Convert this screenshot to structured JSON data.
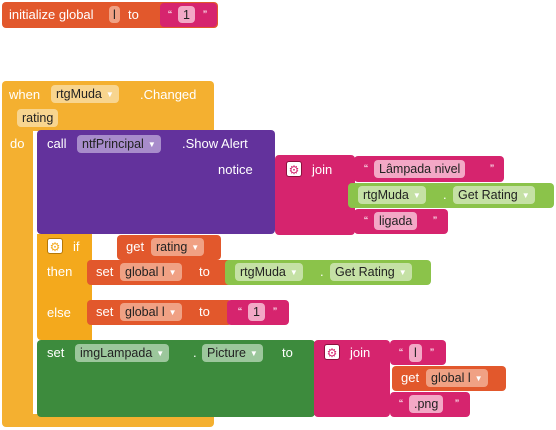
{
  "colors": {
    "orange": "#F4B030",
    "variable": "#E2582C",
    "text_block": "#D6246E",
    "component_purple": "#63329C",
    "component_green": "#3D8B3D",
    "getter_lime": "#8BC34A",
    "control_orange": "#F4A91C"
  },
  "init_global": {
    "label_initialize": "initialize global",
    "var_name": "l",
    "label_to": "to",
    "open_quote": "“",
    "value": "1",
    "close_quote": "”"
  },
  "event": {
    "label_when": "when",
    "component": "rtgMuda",
    "event_name": ".Changed",
    "param": "rating",
    "label_do": "do"
  },
  "call_block": {
    "label_call": "call",
    "component": "ntfPrincipal",
    "method": ".Show Alert",
    "arg_label": "notice",
    "join_label": "join",
    "text1": "Lâmpada nivel",
    "getter_component": "rtgMuda",
    "getter_dot": ".",
    "getter_property": "Get Rating",
    "text2": "ligada"
  },
  "if_block": {
    "label_if": "if",
    "get_label": "get",
    "get_var": "rating",
    "label_then": "then",
    "then_set": "set",
    "then_var": "global l",
    "then_to": "to",
    "then_component": "rtgMuda",
    "then_dot": ".",
    "then_property": "Get Rating",
    "label_else": "else",
    "else_set": "set",
    "else_var": "global l",
    "else_to": "to",
    "else_value": "1"
  },
  "set_picture": {
    "label_set": "set",
    "component": "imgLampada",
    "dot": ".",
    "property": "Picture",
    "label_to": "to",
    "join_label": "join",
    "text1": "l",
    "get_label": "get",
    "get_var": "global l",
    "text2": ".png"
  },
  "quotes": {
    "open": "“",
    "close": "”"
  },
  "icons": [
    "gear-icon",
    "dropdown-arrow-icon"
  ]
}
